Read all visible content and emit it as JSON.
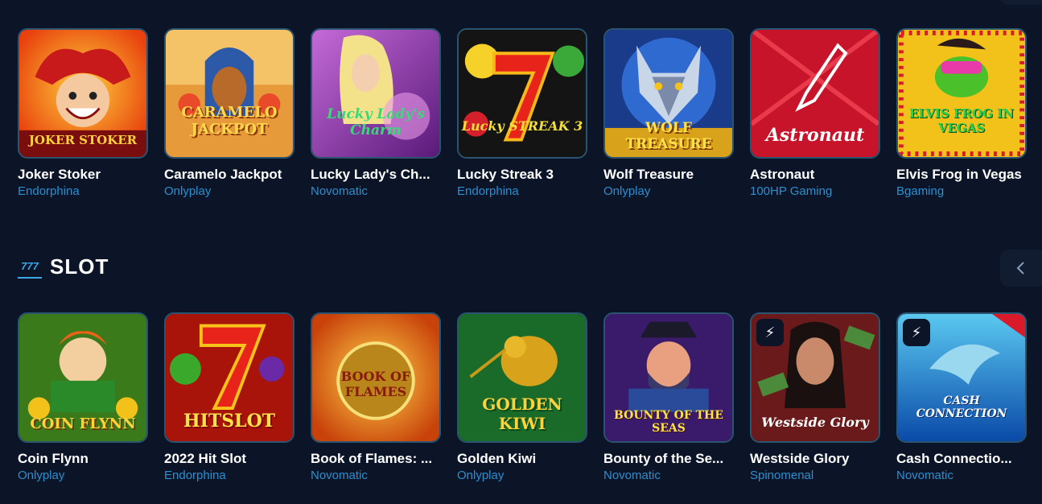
{
  "top_row": [
    {
      "name": "Joker Stoker",
      "provider": "Endorphina",
      "art": "JOKER STOKER"
    },
    {
      "name": "Caramelo Jackpot",
      "provider": "Onlyplay",
      "art": "CARAMELO JACKPOT"
    },
    {
      "name": "Lucky Lady's Ch...",
      "provider": "Novomatic",
      "art": "Lucky Lady's Charm"
    },
    {
      "name": "Lucky Streak 3",
      "provider": "Endorphina",
      "art": "Lucky STREAK 3"
    },
    {
      "name": "Wolf Treasure",
      "provider": "Onlyplay",
      "art": "WOLF TREASURE"
    },
    {
      "name": "Astronaut",
      "provider": "100HP Gaming",
      "art": "Astronaut"
    },
    {
      "name": "Elvis Frog in Vegas",
      "provider": "Bgaming",
      "art": "ELVIS FROG IN VEGAS"
    }
  ],
  "section": {
    "icon": "777",
    "title": "SLOT"
  },
  "slot_row": [
    {
      "name": "Coin Flynn",
      "provider": "Onlyplay",
      "art": "COIN FLYNN"
    },
    {
      "name": "2022 Hit Slot",
      "provider": "Endorphina",
      "art": "HITSLOT"
    },
    {
      "name": "Book of Flames: ...",
      "provider": "Novomatic",
      "art": "BOOK OF FLAMES"
    },
    {
      "name": "Golden Kiwi",
      "provider": "Onlyplay",
      "art": "GOLDEN KIWI"
    },
    {
      "name": "Bounty of the Se...",
      "provider": "Novomatic",
      "art": "BOUNTY OF THE SEAS"
    },
    {
      "name": "Westside Glory",
      "provider": "Spinomenal",
      "art": "Westside Glory"
    },
    {
      "name": "Cash Connectio...",
      "provider": "Novomatic",
      "art": "CASH CONNECTION"
    }
  ],
  "colors": {
    "background": "#0c1528",
    "accent": "#2b8fd0",
    "card_border": "#2a5470"
  }
}
